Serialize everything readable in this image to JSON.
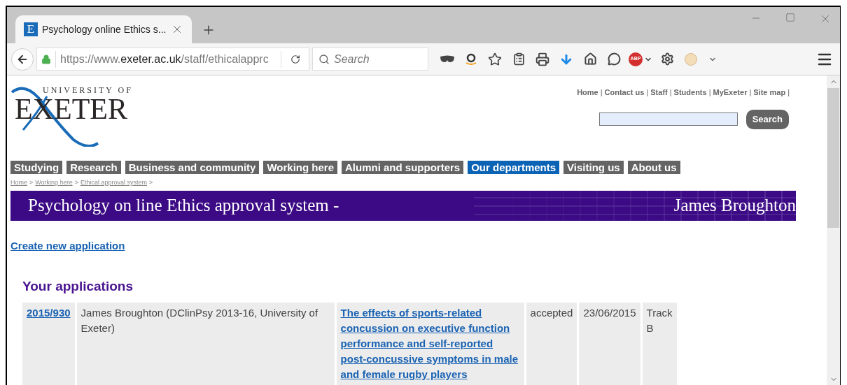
{
  "browser": {
    "tabs": [
      {
        "title": "Psychology online Ethics s...",
        "favicon": "E",
        "selected": true
      }
    ],
    "url": {
      "prefix": "https://www.",
      "domain": "exeter.ac.uk",
      "path": "/staff/ethicalapprc"
    },
    "search": {
      "placeholder": "Search"
    },
    "abp_label": "ABP"
  },
  "page": {
    "logo": {
      "top": "UNIVERSITY OF",
      "main": "EXETER"
    },
    "top_links": [
      {
        "label": "Home",
        "separator": "|"
      },
      {
        "label": "Contact us",
        "separator": "|"
      },
      {
        "label": "Staff",
        "separator": "|"
      },
      {
        "label": "Students",
        "separator": "|"
      },
      {
        "label": "MyExeter",
        "separator": "|"
      },
      {
        "label": "Site map",
        "separator": "|"
      }
    ],
    "site_search": {
      "button": "Search"
    },
    "nav": [
      {
        "label": "Studying",
        "selected": false
      },
      {
        "label": "Research",
        "selected": false
      },
      {
        "label": "Business and community",
        "selected": false
      },
      {
        "label": "Working here",
        "selected": false
      },
      {
        "label": "Alumni and supporters",
        "selected": false
      },
      {
        "label": "Our departments",
        "selected": true
      },
      {
        "label": "Visiting us",
        "selected": false
      },
      {
        "label": "About us",
        "selected": false
      }
    ],
    "breadcrumb": [
      {
        "label": "Home",
        "separator": ">"
      },
      {
        "label": "Working here",
        "separator": ">"
      },
      {
        "label": "Ethical approval system",
        "separator": ">"
      }
    ],
    "banner": {
      "title": "Psychology on line Ethics approval system -",
      "name": "James Broughton"
    },
    "create_link": "Create new application",
    "section_title": "Your applications",
    "applications": [
      {
        "id": "2015/930",
        "applicant": "James Broughton (DClinPsy 2013-16, University of Exeter)",
        "title": "The effects of sports-related concussion on executive function performance and self-reported post-concussive symptoms in male and female rugby players",
        "status": "accepted",
        "date": "23/06/2015",
        "track": "Track B"
      }
    ]
  }
}
